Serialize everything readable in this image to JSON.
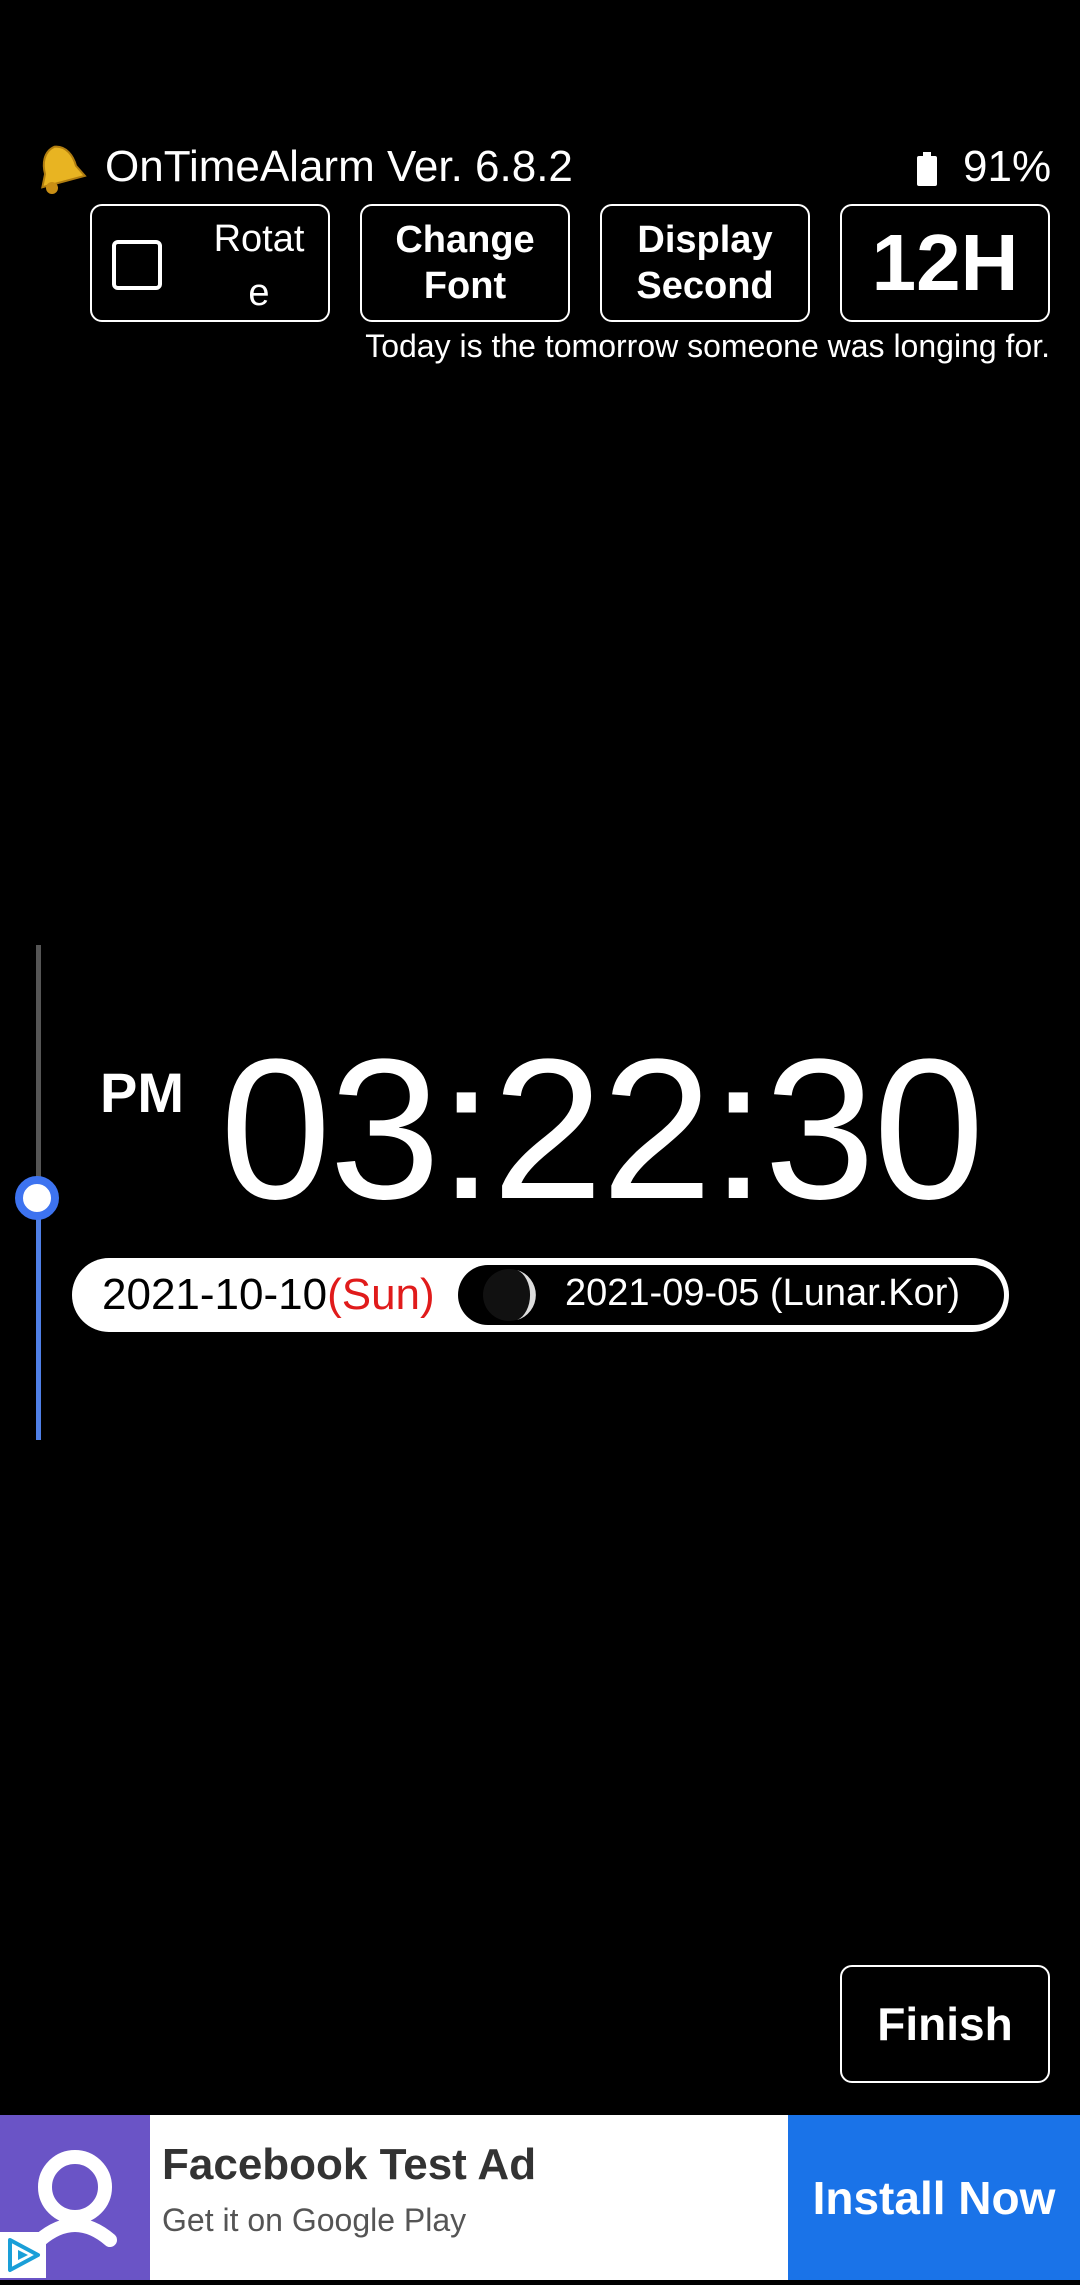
{
  "header": {
    "app_title": "OnTimeAlarm Ver. 6.8.2",
    "battery_percent": "91%",
    "icons": {
      "app": "bell-icon",
      "battery": "battery-icon"
    }
  },
  "toolbar": {
    "rotate_label": "Rotate",
    "rotate_checked": false,
    "change_font_line1": "Change",
    "change_font_line2": "Font",
    "display_second_line1": "Display",
    "display_second_line2": "Second",
    "hour_format_label": "12H"
  },
  "quote": "Today is the tomorrow someone was longing for.",
  "brightness_slider": {
    "value_fraction": 0.49
  },
  "clock": {
    "ampm": "PM",
    "time": "03:22:30"
  },
  "date": {
    "solar": "2021-10-10",
    "weekday": "(Sun)",
    "lunar": "2021-09-05 (Lunar.Kor)",
    "moon_icon": "moon-phase-icon",
    "colors": {
      "weekday": "#e01b1b"
    }
  },
  "finish_label": "Finish",
  "ad": {
    "title": "Facebook Test Ad",
    "subtitle": "Get it on Google Play",
    "install_label": "Install Now",
    "colors": {
      "logo_bg": "#6a54c6",
      "install_bg": "#1a73e8"
    }
  }
}
